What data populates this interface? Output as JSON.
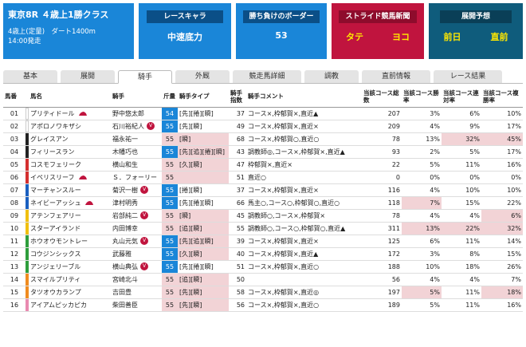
{
  "race": {
    "title": "東京8R ４歳上1勝クラス",
    "line1": "4歳上(定量)　ダート1400m",
    "line2": "14:00発走"
  },
  "race_chara": {
    "label": "レースキャラ",
    "value": "中速底力"
  },
  "border": {
    "label": "勝ち負けのボーダー",
    "value": "53"
  },
  "stride": {
    "label": "ストライド競馬新聞",
    "a": "タテ",
    "b": "ヨコ"
  },
  "tenkai": {
    "label": "展開予想",
    "a": "前日",
    "b": "直前"
  },
  "tabs": [
    "基本",
    "展開",
    "騎手",
    "外厩",
    "競走馬詳細",
    "調教",
    "直前情報",
    "レース結果"
  ],
  "active_tab": "騎手",
  "columns": [
    "馬番",
    "馬名",
    "騎手",
    "斤量",
    "騎手タイプ",
    "騎手指数",
    "騎手コメント",
    "当該コース総数",
    "当該コース勝率",
    "当該コース連対率",
    "当該コース複勝率"
  ],
  "colors": {
    "header_blue": "#1a86d8",
    "stride_red": "#c0143e",
    "tenkai_teal": "#0f5c7c",
    "highlight_pink": "#f2d3d6"
  },
  "rows": [
    {
      "no": "01",
      "waku": "#ffffff",
      "name": "プリティドール",
      "cap": "#c0143e",
      "jockey": "野中悠太郎",
      "mark": "",
      "weight": "54",
      "wtype": "blue",
      "type": "[先][捲][瞬]",
      "tp": false,
      "idx": "37",
      "comment": "コース×,枠郁賀×,直近▲",
      "total": "207",
      "win": "3%",
      "place": "6%",
      "show": "10%",
      "pw": false,
      "pp": false,
      "ps": false
    },
    {
      "no": "02",
      "waku": "#ffffff",
      "name": "アポロノワキザシ",
      "cap": "",
      "jockey": "石川裕紀人",
      "mark": "V",
      "weight": "55",
      "wtype": "blue",
      "type": "[先][瞬]",
      "tp": false,
      "idx": "49",
      "comment": "コース×,枠郁賀×,直近×",
      "total": "209",
      "win": "4%",
      "place": "9%",
      "show": "17%",
      "pw": false,
      "pp": false,
      "ps": false
    },
    {
      "no": "03",
      "waku": "#222222",
      "name": "グレイスアン",
      "cap": "",
      "jockey": "福永祐一",
      "mark": "",
      "weight": "55",
      "wtype": "pink",
      "type": "[瞬]",
      "tp": true,
      "idx": "68",
      "comment": "コース×,枠郁賀○,直近○",
      "total": "78",
      "win": "13%",
      "place": "32%",
      "show": "45%",
      "pw": false,
      "pp": true,
      "ps": true
    },
    {
      "no": "04",
      "waku": "#222222",
      "name": "フィリースラン",
      "cap": "",
      "jockey": "木幡巧也",
      "mark": "",
      "weight": "55",
      "wtype": "blue",
      "type": "[先][追][捲][瞬]",
      "tp": true,
      "idx": "43",
      "comment": "調教師◎,コース×,枠郁賀×,直近▲",
      "total": "93",
      "win": "2%",
      "place": "5%",
      "show": "17%",
      "pw": false,
      "pp": false,
      "ps": false
    },
    {
      "no": "05",
      "waku": "#d43030",
      "name": "コスモフェリーク",
      "cap": "",
      "jockey": "横山和生",
      "mark": "",
      "weight": "55",
      "wtype": "pink",
      "type": "[久][瞬]",
      "tp": true,
      "idx": "47",
      "comment": "枠郁賀×,直近×",
      "total": "22",
      "win": "5%",
      "place": "11%",
      "show": "16%",
      "pw": false,
      "pp": false,
      "ps": false
    },
    {
      "no": "06",
      "waku": "#d43030",
      "name": "イペリスリーフ",
      "cap": "#c0143e",
      "jockey": "Ｓ．フォーリー",
      "mark": "",
      "weight": "55",
      "wtype": "pink",
      "type": "",
      "tp": true,
      "idx": "51",
      "comment": "直近○",
      "total": "0",
      "win": "0%",
      "place": "0%",
      "show": "0%",
      "pw": false,
      "pp": false,
      "ps": false
    },
    {
      "no": "07",
      "waku": "#1a5fc0",
      "name": "マーチャンスルー",
      "cap": "",
      "jockey": "菊沢一樹",
      "mark": "V",
      "weight": "55",
      "wtype": "blue",
      "type": "[捲][瞬]",
      "tp": false,
      "idx": "37",
      "comment": "コース×,枠郁賀×,直近×",
      "total": "116",
      "win": "4%",
      "place": "10%",
      "show": "10%",
      "pw": false,
      "pp": false,
      "ps": false
    },
    {
      "no": "08",
      "waku": "#1a5fc0",
      "name": "ネイビーアッシュ",
      "cap": "#c0143e",
      "jockey": "津村明秀",
      "mark": "",
      "weight": "55",
      "wtype": "blue",
      "type": "[先][捲][瞬]",
      "tp": false,
      "idx": "66",
      "comment": "馬主○,コース○,枠郁賀○,直近○",
      "total": "118",
      "win": "7%",
      "place": "15%",
      "show": "22%",
      "pw": true,
      "pp": false,
      "ps": false
    },
    {
      "no": "09",
      "waku": "#f0c010",
      "name": "アテンフェアリー",
      "cap": "",
      "jockey": "岩部純二",
      "mark": "V",
      "weight": "55",
      "wtype": "pink",
      "type": "[瞬]",
      "tp": true,
      "idx": "45",
      "comment": "調教師○,コース×,枠郁賀×",
      "total": "78",
      "win": "4%",
      "place": "4%",
      "show": "6%",
      "pw": false,
      "pp": false,
      "ps": true
    },
    {
      "no": "10",
      "waku": "#f0c010",
      "name": "スターアイランド",
      "cap": "",
      "jockey": "内田博幸",
      "mark": "",
      "weight": "55",
      "wtype": "pink",
      "type": "[追][瞬]",
      "tp": true,
      "idx": "55",
      "comment": "調教師○,コース○,枠郁賀○,直近▲",
      "total": "311",
      "win": "13%",
      "place": "22%",
      "show": "32%",
      "pw": true,
      "pp": true,
      "ps": true
    },
    {
      "no": "11",
      "waku": "#2e9e3c",
      "name": "ホウオウモントレー",
      "cap": "",
      "jockey": "丸山元気",
      "mark": "V",
      "weight": "55",
      "wtype": "blue",
      "type": "[先][追][瞬]",
      "tp": true,
      "idx": "39",
      "comment": "コース×,枠郁賀×,直近×",
      "total": "125",
      "win": "6%",
      "place": "11%",
      "show": "14%",
      "pw": false,
      "pp": false,
      "ps": false
    },
    {
      "no": "12",
      "waku": "#2e9e3c",
      "name": "コウジンシックス",
      "cap": "",
      "jockey": "武藤雅",
      "mark": "",
      "weight": "55",
      "wtype": "blue",
      "type": "[久][瞬]",
      "tp": true,
      "idx": "40",
      "comment": "コース×,枠郁賀×,直近▲",
      "total": "172",
      "win": "3%",
      "place": "8%",
      "show": "15%",
      "pw": false,
      "pp": false,
      "ps": false
    },
    {
      "no": "13",
      "waku": "#2e9e3c",
      "name": "アンジェリーブル",
      "cap": "",
      "jockey": "横山典弘",
      "mark": "V",
      "weight": "55",
      "wtype": "blue",
      "type": "[先][捲][瞬]",
      "tp": false,
      "idx": "51",
      "comment": "コース×,枠郁賀×,直近○",
      "total": "188",
      "win": "10%",
      "place": "18%",
      "show": "26%",
      "pw": false,
      "pp": false,
      "ps": false
    },
    {
      "no": "14",
      "waku": "#f08c20",
      "name": "スマイルプリティ",
      "cap": "",
      "jockey": "宮崎北斗",
      "mark": "",
      "weight": "55",
      "wtype": "pink",
      "type": "[追][瞬]",
      "tp": true,
      "idx": "50",
      "comment": "",
      "total": "56",
      "win": "4%",
      "place": "4%",
      "show": "7%",
      "pw": false,
      "pp": false,
      "ps": false
    },
    {
      "no": "15",
      "waku": "#f08c20",
      "name": "タツオウカランプ",
      "cap": "",
      "jockey": "吉田豊",
      "mark": "",
      "weight": "55",
      "wtype": "pink",
      "type": "[先][瞬]",
      "tp": true,
      "idx": "58",
      "comment": "コース×,枠郁賀×,直近◎",
      "total": "197",
      "win": "5%",
      "place": "11%",
      "show": "18%",
      "pw": true,
      "pp": false,
      "ps": true
    },
    {
      "no": "16",
      "waku": "#e98ab0",
      "name": "アイアムピッカピカ",
      "cap": "",
      "jockey": "柴田善臣",
      "mark": "",
      "weight": "55",
      "wtype": "pink",
      "type": "[先][瞬]",
      "tp": true,
      "idx": "56",
      "comment": "コース×,枠郁賀×,直近○",
      "total": "189",
      "win": "5%",
      "place": "11%",
      "show": "16%",
      "pw": false,
      "pp": false,
      "ps": false
    }
  ]
}
